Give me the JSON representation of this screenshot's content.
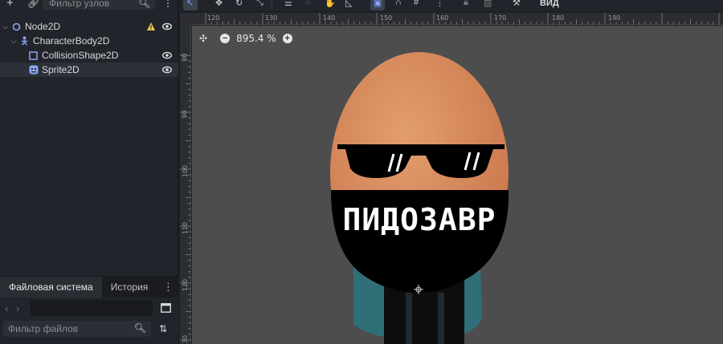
{
  "scene_dock": {
    "filter_placeholder": "Фильтр узлов",
    "nodes": [
      {
        "label": "Node2D"
      },
      {
        "label": "CharacterBody2D"
      },
      {
        "label": "CollisionShape2D"
      },
      {
        "label": "Sprite2D"
      }
    ]
  },
  "files_dock": {
    "tabs": [
      "Файловая система",
      "История"
    ],
    "filter_placeholder": "Фильтр файлов"
  },
  "viewport": {
    "view_menu": "ВИД",
    "zoom_level": "895.4 %",
    "ruler_top": [
      "120",
      "130",
      "140",
      "150",
      "160",
      "170",
      "180",
      "190"
    ],
    "ruler_left": [
      "80",
      "90",
      "100",
      "110",
      "120",
      "130"
    ],
    "sprite_text": "ПИДОЗАВР"
  },
  "colors": {
    "node2d": "#8da5f3",
    "body": "#8da5f3",
    "canvas": "#4d4d4d",
    "egg": "#d98a5c",
    "warning": "#f0c94a"
  }
}
